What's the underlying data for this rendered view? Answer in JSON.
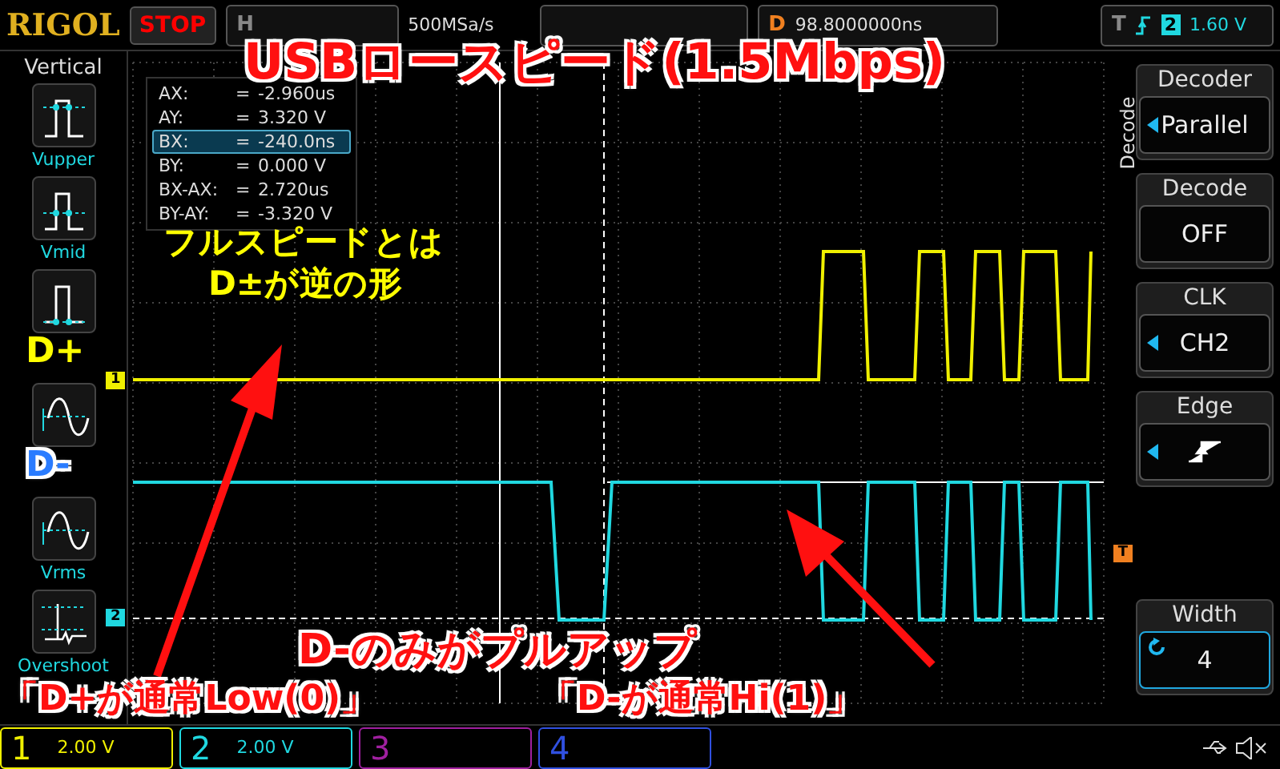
{
  "top_bar": {
    "logo": "RIGOL",
    "run_state": "STOP",
    "timebase_label": "H",
    "sample_rate": "500MSa/s",
    "delay_label": "D",
    "delay": "98.8000000ns"
  },
  "trigger": {
    "label": "T",
    "source": "2",
    "voltage": "1.60 V"
  },
  "cursor_readout": [
    {
      "label": "AX:",
      "eq": "=",
      "value": "-2.960us",
      "selected": false
    },
    {
      "label": "AY:",
      "eq": "=",
      "value": "3.320 V",
      "selected": false
    },
    {
      "label": "BX:",
      "eq": "=",
      "value": "-240.0ns",
      "selected": true
    },
    {
      "label": "BY:",
      "eq": "=",
      "value": "0.000 V",
      "selected": false
    },
    {
      "label": "BX-AX:",
      "eq": "=",
      "value": "2.720us",
      "selected": false
    },
    {
      "label": "BY-AY:",
      "eq": "=",
      "value": "-3.320 V",
      "selected": false
    }
  ],
  "vertical_menu": {
    "title": "Vertical",
    "items": [
      {
        "kind": "top",
        "label": "Vupper"
      },
      {
        "kind": "mid",
        "label": "Vmid"
      },
      {
        "kind": "base"
      },
      {
        "kind": "sine"
      },
      {
        "kind": "sine",
        "label": "Vrms"
      },
      {
        "kind": "overshoot",
        "label": "Overshoot"
      }
    ]
  },
  "decode_menu": {
    "title": "Decode",
    "items": [
      {
        "kind": "select",
        "heading": "Decoder",
        "value": "Parallel"
      },
      {
        "kind": "plain",
        "heading": "Decode",
        "value": "OFF"
      },
      {
        "kind": "select",
        "heading": "CLK",
        "value": "CH2"
      },
      {
        "kind": "edge",
        "heading": "Edge"
      },
      {
        "kind": "knob",
        "heading": "Width",
        "value": "4"
      }
    ]
  },
  "trace_markers": [
    {
      "text": "1",
      "color": "#f0f000"
    },
    {
      "text": "2",
      "color": "#20d8e0"
    }
  ],
  "trigger_marker": "T",
  "channels": [
    {
      "number": "1",
      "scale": "2.00 V",
      "color": "#f0f000"
    },
    {
      "number": "2",
      "scale": "2.00 V",
      "color": "#20d8e0"
    },
    {
      "number": "3",
      "color": "#a020a0"
    },
    {
      "number": "4",
      "color": "#3050e0"
    }
  ],
  "title": "USBロースピード(1.5Mbps)",
  "note": [
    "フルスピードとは",
    "D±が逆の形"
  ],
  "trace_labels": [
    {
      "text": "D+",
      "color": "#ffff00"
    },
    {
      "text": "D-",
      "color": "#2a7cff"
    }
  ],
  "callout": "D-のみがプルアップ",
  "captions": [
    "「D+が通常Low(0)」",
    "「D-が通常Hi(1)」"
  ]
}
